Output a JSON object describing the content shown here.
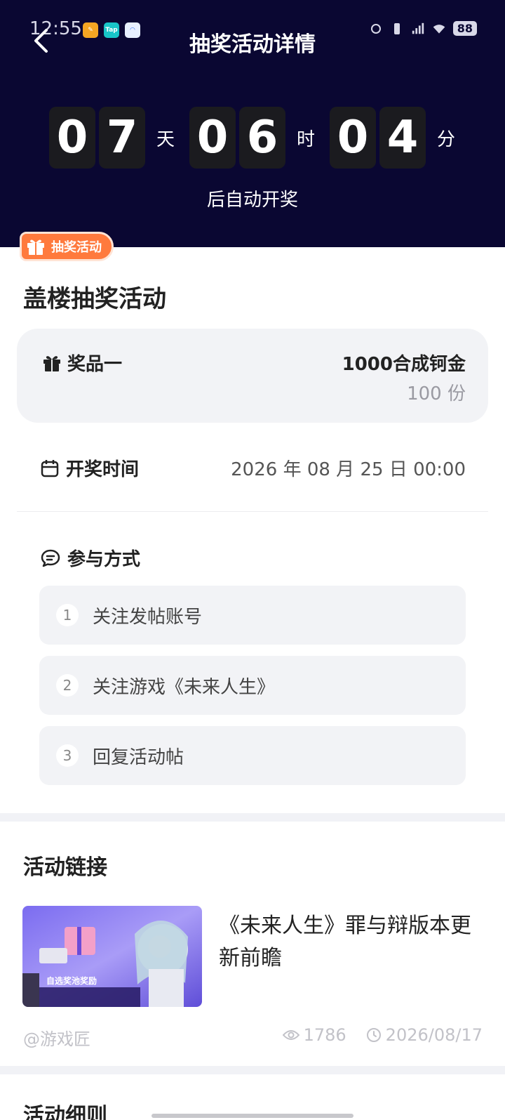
{
  "status_bar": {
    "time": "12:55",
    "battery": "88",
    "app_icons": [
      "app-icon-orange",
      "taptap-icon",
      "browser-icon"
    ],
    "app_badge": "Tap"
  },
  "header": {
    "title": "抽奖活动详情",
    "countdown": {
      "days": [
        "0",
        "7"
      ],
      "hours": [
        "0",
        "6"
      ],
      "minutes": [
        "0",
        "4"
      ],
      "unit_day": "天",
      "unit_hour": "时",
      "unit_minute": "分"
    },
    "auto_draw_text": "后自动开奖"
  },
  "badge": {
    "label": "抽奖活动"
  },
  "activity": {
    "title": "盖楼抽奖活动",
    "prize": {
      "label": "奖品一",
      "name": "1000合成钶金",
      "count": "100 份"
    },
    "draw_time": {
      "label": "开奖时间",
      "value": "2026 年 08 月 25 日 00:00"
    },
    "join": {
      "label": "参与方式",
      "steps": [
        {
          "num": "1",
          "text": "关注发帖账号"
        },
        {
          "num": "2",
          "text": "关注游戏《未来人生》"
        },
        {
          "num": "3",
          "text": "回复活动帖"
        }
      ]
    }
  },
  "link_section": {
    "title": "活动链接",
    "article": {
      "title": "《未来人生》罪与辩版本更新前瞻",
      "thumb_caption": "自选奖池奖励",
      "author": "@游戏匠",
      "views": "1786",
      "date": "2026/08/17"
    }
  },
  "rules_section": {
    "title": "活动细则"
  },
  "colors": {
    "header_bg": "#0a0732",
    "accent": "#ff7a3d",
    "card_bg": "#f2f3f6"
  }
}
